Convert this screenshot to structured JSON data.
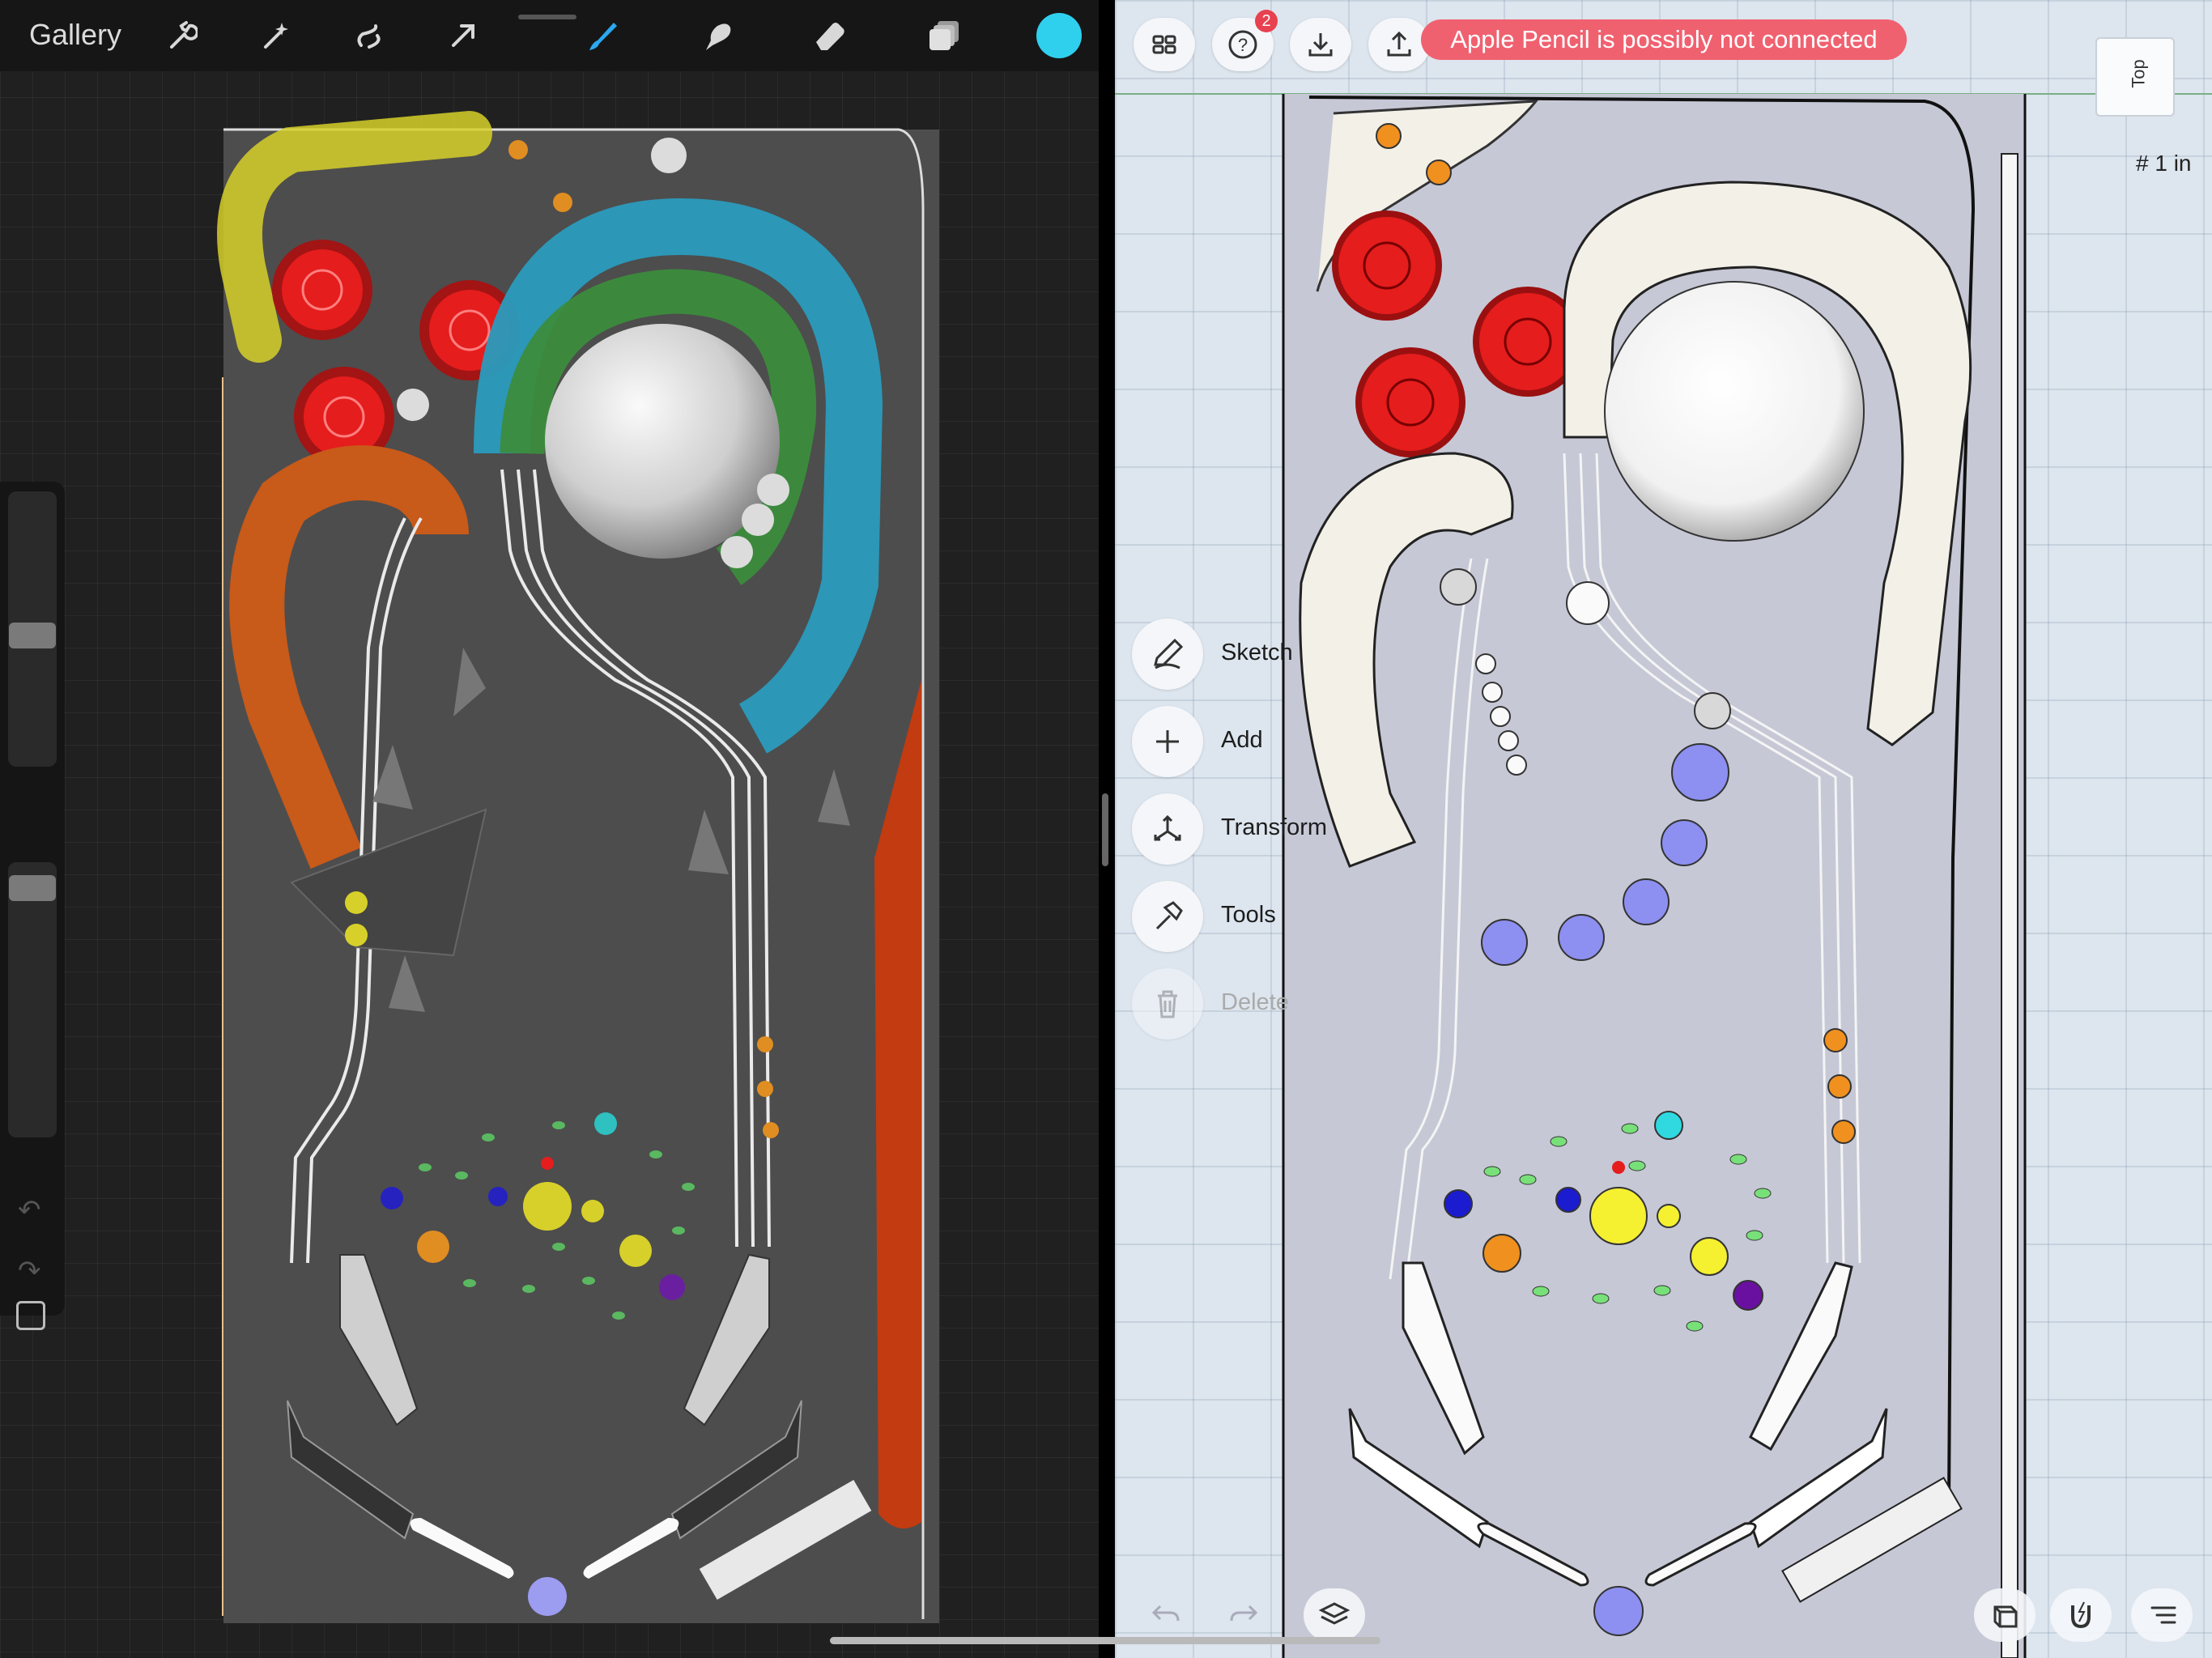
{
  "procreate": {
    "gallery_label": "Gallery",
    "icons": [
      "wrench-icon",
      "magic-wand-icon",
      "selection-icon",
      "transform-arrow-icon",
      "brush-icon",
      "smudge-icon",
      "eraser-icon",
      "layers-icon",
      "color-swatch"
    ],
    "active_color": "#2fd0ee"
  },
  "shapr": {
    "help_badge": "2",
    "toast": "Apple Pencil is possibly not connected",
    "viewcube_label": "Top",
    "scale_label": "# 1 in",
    "menu": {
      "sketch": "Sketch",
      "add": "Add",
      "transform": "Transform",
      "tools": "Tools",
      "delete": "Delete"
    }
  },
  "colors": {
    "procreate_bg": "#202020",
    "shapr_bg": "#dde5ee",
    "toast": "#f06170",
    "bumper_red": "#e51d1d",
    "ramp_blue": "#2a9bbd",
    "ramp_green": "#3b8c3c",
    "ramp_orange": "#c85a1a",
    "ramp_yellow": "#d7d02a"
  }
}
